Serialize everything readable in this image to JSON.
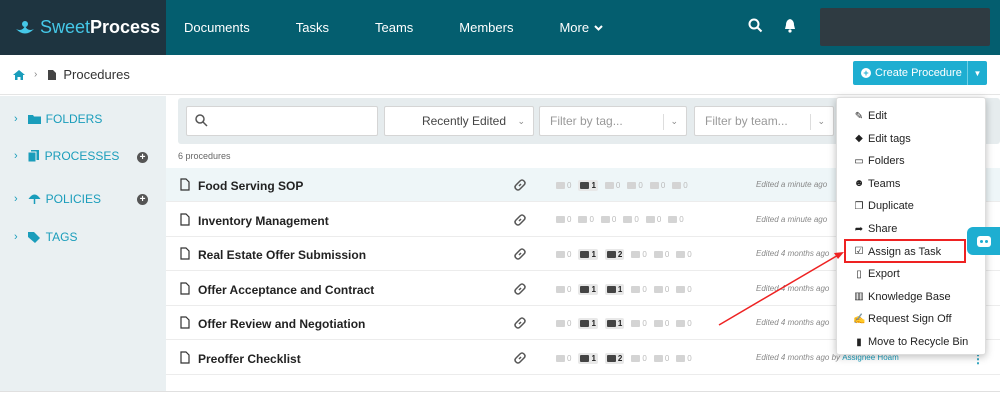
{
  "colors": {
    "nav_bg": "#045e6f",
    "logo_bg": "#1e3440",
    "accent": "#1eaed1",
    "sidebar_bg": "#eaf0f2",
    "highlight": "#e22222"
  },
  "brand": {
    "sweet": "Sweet",
    "process": "Process"
  },
  "nav": {
    "items": [
      "Documents",
      "Tasks",
      "Teams",
      "Members"
    ],
    "more": "More"
  },
  "breadcrumb": {
    "current": "Procedures"
  },
  "create_button": {
    "label": "Create Procedure"
  },
  "sidebar": {
    "folders": "FOLDERS",
    "processes": "PROCESSES",
    "policies": "POLICIES",
    "tags": "TAGS"
  },
  "filters": {
    "search_placeholder": "",
    "sort": "Recently Edited",
    "tag_placeholder": "Filter by tag...",
    "team_placeholder": "Filter by team..."
  },
  "count_label": "6 procedures",
  "rows": [
    {
      "title": "Food Serving SOP",
      "stats": [
        "0",
        "1",
        "0",
        "0",
        "0",
        "0"
      ],
      "edited": "Edited a minute ago",
      "author": ""
    },
    {
      "title": "Inventory Management",
      "stats": [
        "0",
        "0",
        "0",
        "0",
        "0",
        "0"
      ],
      "edited": "Edited a minute ago",
      "author": ""
    },
    {
      "title": "Real Estate Offer Submission",
      "stats": [
        "0",
        "1",
        "2",
        "0",
        "0",
        "0"
      ],
      "edited": "Edited 4 months ago",
      "author": ""
    },
    {
      "title": "Offer Acceptance and Contract",
      "stats": [
        "0",
        "1",
        "1",
        "0",
        "0",
        "0"
      ],
      "edited": "Edited 4 months ago",
      "author": ""
    },
    {
      "title": "Offer Review and Negotiation",
      "stats": [
        "0",
        "1",
        "1",
        "0",
        "0",
        "0"
      ],
      "edited": "Edited 4 months ago",
      "author": ""
    },
    {
      "title": "Preoffer Checklist",
      "stats": [
        "0",
        "1",
        "2",
        "0",
        "0",
        "0"
      ],
      "edited": "Edited 4 months ago by",
      "author": "Assignee Hoam"
    }
  ],
  "menu": {
    "items": [
      {
        "label": "Edit",
        "icon": "pencil-icon"
      },
      {
        "label": "Edit tags",
        "icon": "tag-icon"
      },
      {
        "label": "Folders",
        "icon": "folder-icon"
      },
      {
        "label": "Teams",
        "icon": "users-icon"
      },
      {
        "label": "Duplicate",
        "icon": "copy-icon"
      },
      {
        "label": "Share",
        "icon": "share-icon"
      },
      {
        "label": "Assign as Task",
        "icon": "checkbox-icon"
      },
      {
        "label": "Export",
        "icon": "file-icon"
      },
      {
        "label": "Knowledge Base",
        "icon": "book-icon"
      },
      {
        "label": "Request Sign Off",
        "icon": "signature-icon"
      },
      {
        "label": "Move to Recycle Bin",
        "icon": "trash-icon"
      }
    ]
  }
}
